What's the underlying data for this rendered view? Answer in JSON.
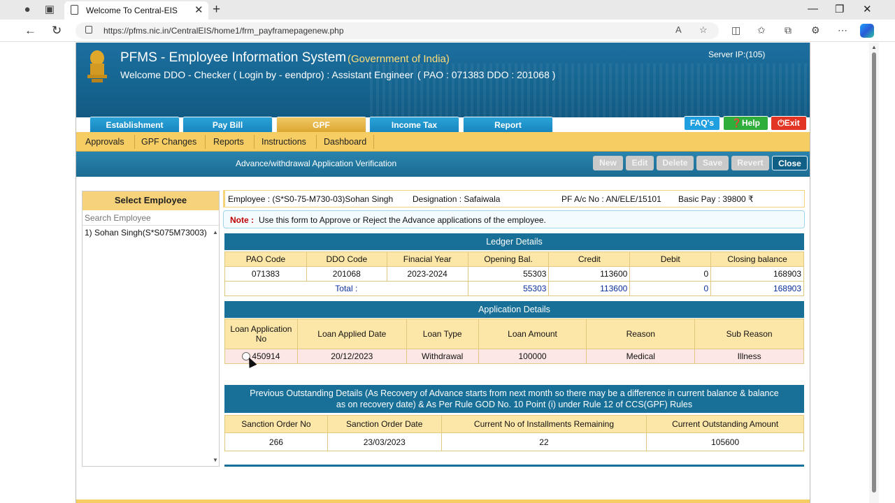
{
  "browser": {
    "tab_title": "Welcome To Central-EIS",
    "url": "https://pfms.nic.in/CentralEIS/home1/frm_payframepagenew.php"
  },
  "header": {
    "title": "PFMS - Employee Information System",
    "subtitle": "(Government of India)",
    "welcome": "Welcome DDO - Checker ( Login by - eendpro) : Assistant Engineer",
    "pao_ddo": "( PAO : 071383 DDO : 201068 )",
    "server": "Server IP:(105)"
  },
  "main_tabs": [
    "Establishment",
    "Pay Bill",
    "GPF",
    "Income Tax",
    "Report"
  ],
  "active_tab": "GPF",
  "header_buttons": {
    "faq": "FAQ's",
    "help": "Help",
    "exit": "Exit"
  },
  "submenu": [
    "Approvals",
    "GPF Changes",
    "Reports",
    "Instructions",
    "Dashboard"
  ],
  "toolbar": {
    "title": "Advance/withdrawal Application Verification",
    "buttons": [
      "New",
      "Edit",
      "Delete",
      "Save",
      "Revert",
      "Close"
    ]
  },
  "select_employee": {
    "heading": "Select Employee",
    "search_placeholder": "Search Employee",
    "item": "1) Sohan Singh(S*S075M73003)"
  },
  "employee": {
    "name": "Employee : (S*S0-75-M730-03)Sohan Singh",
    "designation": "Designation : Safaiwala",
    "pf": "PF A/c No : AN/ELE/15101",
    "basic": "Basic Pay : 39800 ₹"
  },
  "note": {
    "label": "Note :",
    "text": "Use this form to Approve or Reject the Advance applications of the employee."
  },
  "ledger": {
    "heading": "Ledger Details",
    "columns": [
      "PAO Code",
      "DDO Code",
      "Finacial Year",
      "Opening Bal.",
      "Credit",
      "Debit",
      "Closing balance"
    ],
    "row": [
      "071383",
      "201068",
      "2023-2024",
      "55303",
      "113600",
      "0",
      "168903"
    ],
    "total_label": "Total :",
    "totals": [
      "55303",
      "113600",
      "0",
      "168903"
    ]
  },
  "application": {
    "heading": "Application Details",
    "columns": [
      "Loan Application No",
      "Loan Applied Date",
      "Loan Type",
      "Loan Amount",
      "Reason",
      "Sub Reason"
    ],
    "row": [
      "450914",
      "20/12/2023",
      "Withdrawal",
      "100000",
      "Medical",
      "Illness"
    ]
  },
  "outstanding": {
    "heading_line1": "Previous Outstanding Details (As Recovery of Advance starts from next month so there may be a difference in current balance & balance",
    "heading_line2": "as on recovery date) & As Per Rule GOD No. 10 Point (i) under Rule 12 of CCS(GPF) Rules",
    "columns": [
      "Sanction Order No",
      "Sanction Order Date",
      "Current No of Installments Remaining",
      "Current Outstanding Amount"
    ],
    "row": [
      "266",
      "23/03/2023",
      "22",
      "105600"
    ]
  }
}
